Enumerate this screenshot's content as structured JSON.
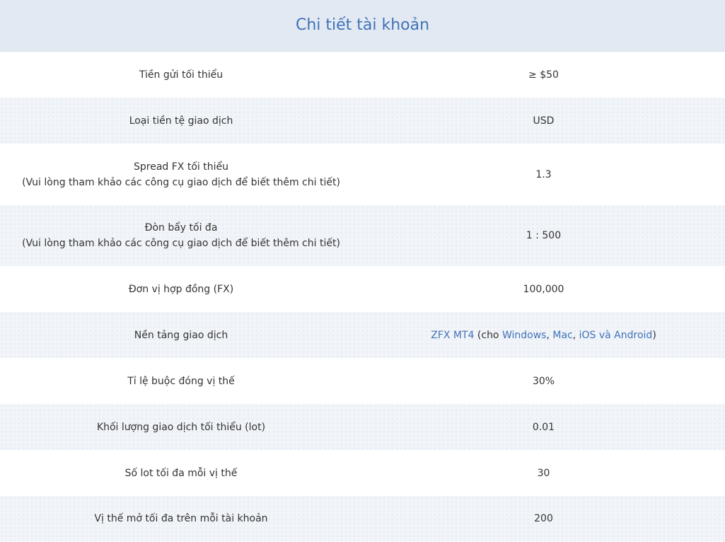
{
  "header": {
    "title": "Chi tiết tài khoản"
  },
  "rows": [
    {
      "label": "Tiền gửi tối thiểu",
      "value": "≥ $50"
    },
    {
      "label": "Loại tiền tệ giao dịch",
      "value": "USD"
    },
    {
      "label": "Spread FX tối thiểu",
      "sublabel": "(Vui lòng tham khảo các công cụ giao dịch để biết thêm chi tiết)",
      "value": "1.3"
    },
    {
      "label": "Đòn bẩy tối đa",
      "sublabel": "(Vui lòng tham khảo các công cụ giao dịch để biết thêm chi tiết)",
      "value": "1 : 500"
    },
    {
      "label": "Đơn vị hợp đồng (FX)",
      "value": "100,000"
    },
    {
      "label": "Nền tảng giao dịch",
      "platform": {
        "main_link": "ZFX MT4",
        "open": " (cho ",
        "windows": "Windows",
        "sep1": ", ",
        "mac": "Mac",
        "sep2": ", ",
        "ios_android": "iOS và Android",
        "close": ")"
      }
    },
    {
      "label": "Tỉ lệ buộc đóng vị thế",
      "value": "30%"
    },
    {
      "label": "Khối lượng giao dịch tối thiểu (lot)",
      "value": "0.01"
    },
    {
      "label": "Số lot tối đa mỗi vị thế",
      "value": "30"
    },
    {
      "label": "Vị thế mở tối đa trên mỗi tài khoản",
      "value": "200"
    }
  ],
  "colors": {
    "accent": "#3f72b8",
    "header_bg": "#e3e9f2",
    "alt_row_bg": "#f1f4f8"
  }
}
